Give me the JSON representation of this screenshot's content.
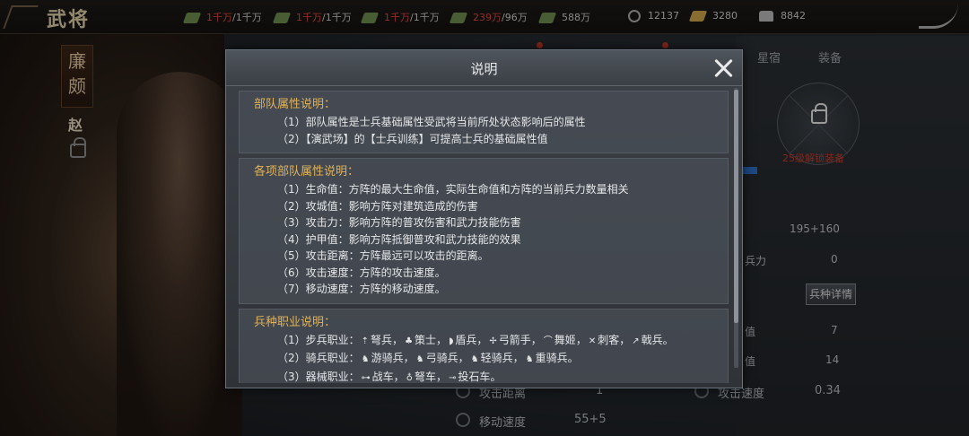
{
  "topbar": {
    "title": "武将",
    "resources": [
      {
        "current": "1千万",
        "max": "/1千万"
      },
      {
        "current": "1千万",
        "max": "/1千万"
      },
      {
        "current": "1千万",
        "max": "/1千万"
      },
      {
        "current": "239万",
        "max": "/96万"
      },
      {
        "value": "588万"
      },
      {
        "value": "12137"
      },
      {
        "value": "3280"
      },
      {
        "value": "8842"
      }
    ]
  },
  "hero": {
    "name": "廉颇",
    "country": "赵"
  },
  "right_panel": {
    "tabs": [
      "星宿",
      "装备"
    ],
    "unlock_note": "25级解锁装备",
    "stats": {
      "v1": "195+160",
      "label2": "兵力",
      "v2": "0",
      "detail_button": "兵种详情",
      "label3": "值",
      "v3": "7",
      "label4": "值",
      "v4": "14",
      "attack_range_label": "攻击距离",
      "attack_range_value": "1",
      "attack_speed_label": "攻击速度",
      "attack_speed_value": "0.34",
      "move_speed_label": "移动速度",
      "move_speed_value": "55+5"
    }
  },
  "dialog": {
    "title": "说明",
    "sections": [
      {
        "title": "部队属性说明：",
        "lines": [
          "（1）部队属性是士兵基础属性受武将当前所处状态影响后的属性",
          "（2）【演武场】的【士兵训练】可提高士兵的基础属性值"
        ]
      },
      {
        "title": "各项部队属性说明：",
        "lines": [
          "（1）生命值：方阵的最大生命值，实际生命值和方阵的当前兵力数量相关",
          "（2）攻城值：影响方阵对建筑造成的伤害",
          "（3）攻击力：影响方阵的普攻伤害和武力技能伤害",
          "（4）护甲值：影响方阵抵御普攻和武力技能的效果",
          "（5）攻击距离：方阵最远可以攻击的距离。",
          "（6）攻击速度：方阵的攻击速度。",
          "（7）移动速度：方阵的移动速度。"
        ]
      },
      {
        "title": "兵种职业说明：",
        "lines": [
          {
            "prefix": "（1）步兵职业：",
            "items": [
              "弩兵",
              "策士",
              "盾兵",
              "弓箭手",
              "舞姬",
              "刺客",
              "戟兵"
            ],
            "end": "。"
          },
          {
            "prefix": "（2）骑兵职业：",
            "items": [
              "游骑兵",
              "弓骑兵",
              "轻骑兵",
              "重骑兵"
            ],
            "end": "。"
          },
          {
            "prefix": "（3）器械职业：",
            "items": [
              "战车",
              "弩车",
              "投石车"
            ],
            "end": "。"
          }
        ]
      }
    ]
  }
}
